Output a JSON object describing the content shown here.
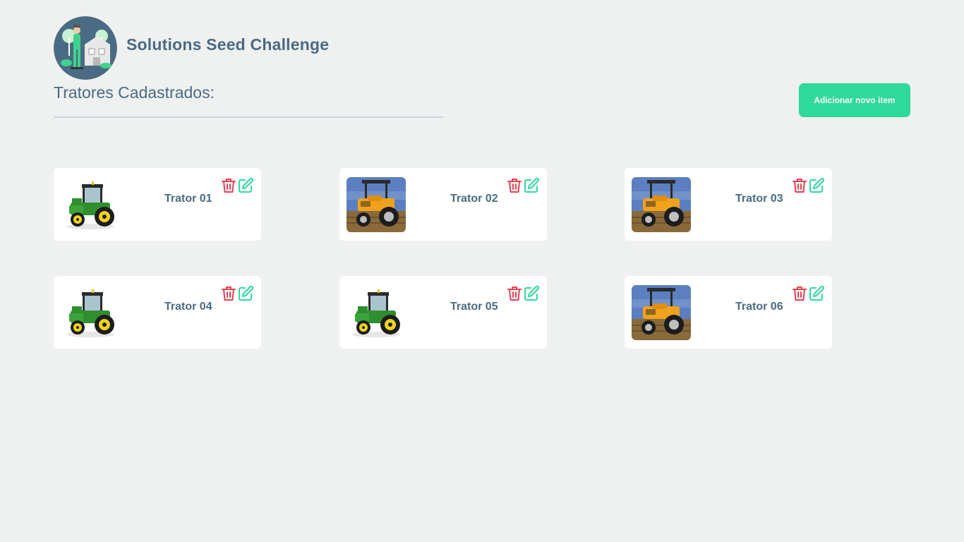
{
  "header": {
    "app_title": "Solutions Seed Challenge",
    "logo_icon": "farmer-avatar-icon"
  },
  "main": {
    "section_title": "Tratores Cadastrados:",
    "add_button_label": "Adicionar novo item"
  },
  "cards": [
    {
      "name": "Trator 01",
      "image": "green-tractor"
    },
    {
      "name": "Trator 02",
      "image": "yellow-tractor-field"
    },
    {
      "name": "Trator 03",
      "image": "yellow-tractor-field"
    },
    {
      "name": "Trator 04",
      "image": "green-tractor"
    },
    {
      "name": "Trator 05",
      "image": "green-tractor"
    },
    {
      "name": "Trator 06",
      "image": "yellow-tractor-field"
    }
  ],
  "icons": {
    "delete": "trash-icon",
    "edit": "edit-icon"
  },
  "colors": {
    "background": "#eff0f0",
    "primary_text": "#4a6b83",
    "accent": "#2fd99b",
    "danger": "#e8404f"
  }
}
